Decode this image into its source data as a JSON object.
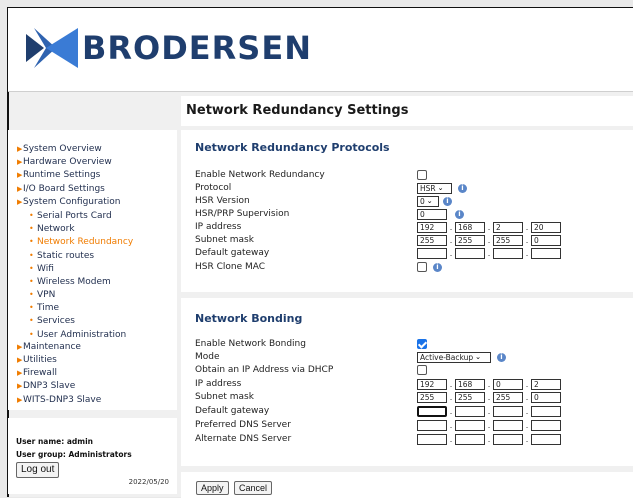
{
  "brand": {
    "name": "BRODERSEN"
  },
  "page": {
    "title": "Network Redundancy Settings"
  },
  "sidebar": {
    "items": [
      {
        "label": "System Overview",
        "level": 0
      },
      {
        "label": "Hardware Overview",
        "level": 0
      },
      {
        "label": "Runtime Settings",
        "level": 0
      },
      {
        "label": "I/O Board Settings",
        "level": 0
      },
      {
        "label": "System Configuration",
        "level": 0
      },
      {
        "label": "Serial Ports Card",
        "level": 1
      },
      {
        "label": "Network",
        "level": 1
      },
      {
        "label": "Network Redundancy",
        "level": 1,
        "active": true
      },
      {
        "label": "Static routes",
        "level": 1
      },
      {
        "label": "Wifi",
        "level": 1
      },
      {
        "label": "Wireless Modem",
        "level": 1
      },
      {
        "label": "VPN",
        "level": 1
      },
      {
        "label": "Time",
        "level": 1
      },
      {
        "label": "Services",
        "level": 1
      },
      {
        "label": "User Administration",
        "level": 1
      },
      {
        "label": "Maintenance",
        "level": 0
      },
      {
        "label": "Utilities",
        "level": 0
      },
      {
        "label": "Firewall",
        "level": 0
      },
      {
        "label": "DNP3 Slave",
        "level": 0
      },
      {
        "label": "WITS-DNP3 Slave",
        "level": 0
      }
    ]
  },
  "user": {
    "name_line": "User name: admin",
    "group_line": "User group: Administrators",
    "logout_label": "Log out",
    "date": "2022/05/20"
  },
  "redundancy": {
    "title": "Network Redundancy Protocols",
    "labels": {
      "enable": "Enable Network Redundancy",
      "protocol": "Protocol",
      "hsr_version": "HSR Version",
      "supervision": "HSR/PRP Supervision",
      "ip": "IP address",
      "mask": "Subnet mask",
      "gateway": "Default gateway",
      "clone_mac": "HSR Clone MAC"
    },
    "protocol": "HSR",
    "hsr_version": "0",
    "supervision": "0",
    "ip": [
      "192",
      "168",
      "2",
      "20"
    ],
    "mask": [
      "255",
      "255",
      "255",
      "0"
    ],
    "gateway": [
      "",
      "",
      "",
      ""
    ]
  },
  "bonding": {
    "title": "Network Bonding",
    "labels": {
      "enable": "Enable Network Bonding",
      "mode": "Mode",
      "dhcp": "Obtain an IP Address via DHCP",
      "ip": "IP address",
      "mask": "Subnet mask",
      "gateway": "Default gateway",
      "dns1": "Preferred DNS Server",
      "dns2": "Alternate DNS Server"
    },
    "mode": "Active-Backup",
    "ip": [
      "192",
      "168",
      "0",
      "2"
    ],
    "mask": [
      "255",
      "255",
      "255",
      "0"
    ],
    "gateway": [
      "",
      "",
      "",
      ""
    ],
    "dns1": [
      "",
      "",
      "",
      ""
    ],
    "dns2": [
      "",
      "",
      "",
      ""
    ]
  },
  "footer": {
    "apply_label": "Apply",
    "cancel_label": "Cancel"
  },
  "colors": {
    "brand_blue": "#1f3e6e",
    "accent_orange": "#f07c00",
    "info_blue": "#5a86c8"
  }
}
